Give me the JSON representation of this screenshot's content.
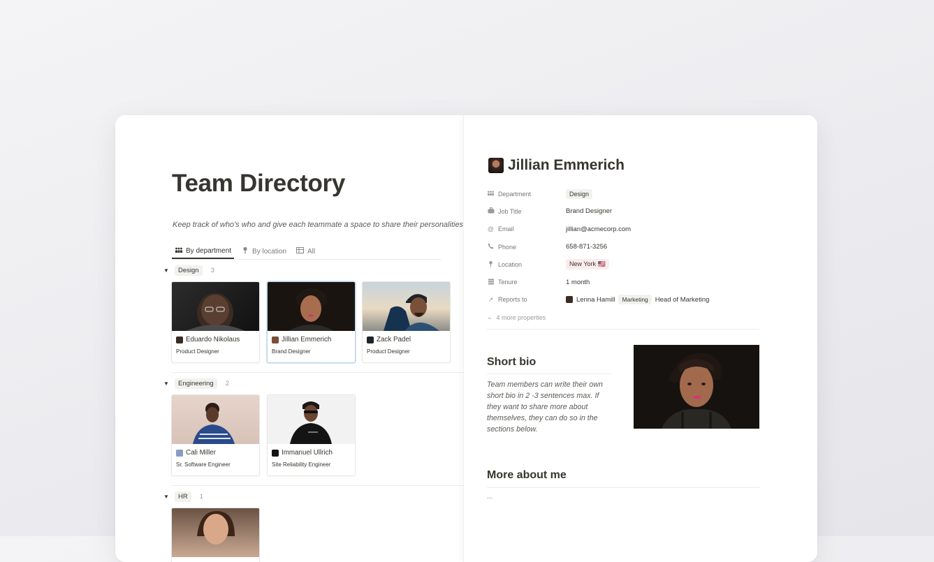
{
  "page": {
    "title": "Team Directory",
    "description": "Keep track of who's who and give each teammate a space to share their personalities."
  },
  "tabs": [
    {
      "label": "By department",
      "icon": "people-icon",
      "active": true
    },
    {
      "label": "By location",
      "icon": "pin-icon",
      "active": false
    },
    {
      "label": "All",
      "icon": "table-icon",
      "active": false
    }
  ],
  "groups": [
    {
      "name": "Design",
      "count": "3",
      "cards": [
        {
          "name": "Eduardo Nikolaus",
          "role": "Product Designer"
        },
        {
          "name": "Jillian Emmerich",
          "role": "Brand Designer"
        },
        {
          "name": "Zack Padel",
          "role": "Product Designer"
        }
      ]
    },
    {
      "name": "Engineering",
      "count": "2",
      "cards": [
        {
          "name": "Cali Miller",
          "role": "Sr. Software Engineer"
        },
        {
          "name": "Immanuel Ullrich",
          "role": "Site Reliability Engineer"
        }
      ]
    },
    {
      "name": "HR",
      "count": "1",
      "cards": [
        {
          "name": "",
          "role": ""
        }
      ]
    }
  ],
  "profile": {
    "name": "Jillian Emmerich",
    "properties": {
      "department": {
        "label": "Department",
        "value": "Design"
      },
      "job_title": {
        "label": "Job Title",
        "value": "Brand Designer"
      },
      "email": {
        "label": "Email",
        "value": "jillian@acmecorp.com"
      },
      "phone": {
        "label": "Phone",
        "value": "658-871-3256"
      },
      "location": {
        "label": "Location",
        "value": "New York 🇺🇸"
      },
      "tenure": {
        "label": "Tenure",
        "value": "1 month"
      },
      "reports_to": {
        "label": "Reports to",
        "person": "Lenna Hamill",
        "dept": "Marketing",
        "title": "Head of Marketing"
      }
    },
    "more_properties": "4 more properties",
    "short_bio_heading": "Short bio",
    "short_bio": "Team members can write their own short bio in 2 -3 sentences max. If they want to share more about themselves, they can do so in the sections below.",
    "more_about_heading": "More about me",
    "more_about_text": "..."
  },
  "colors": {
    "text": "#37352f",
    "muted": "#787774",
    "tag_bg": "#f1f1ef",
    "selected_border": "#bcd6ea"
  }
}
